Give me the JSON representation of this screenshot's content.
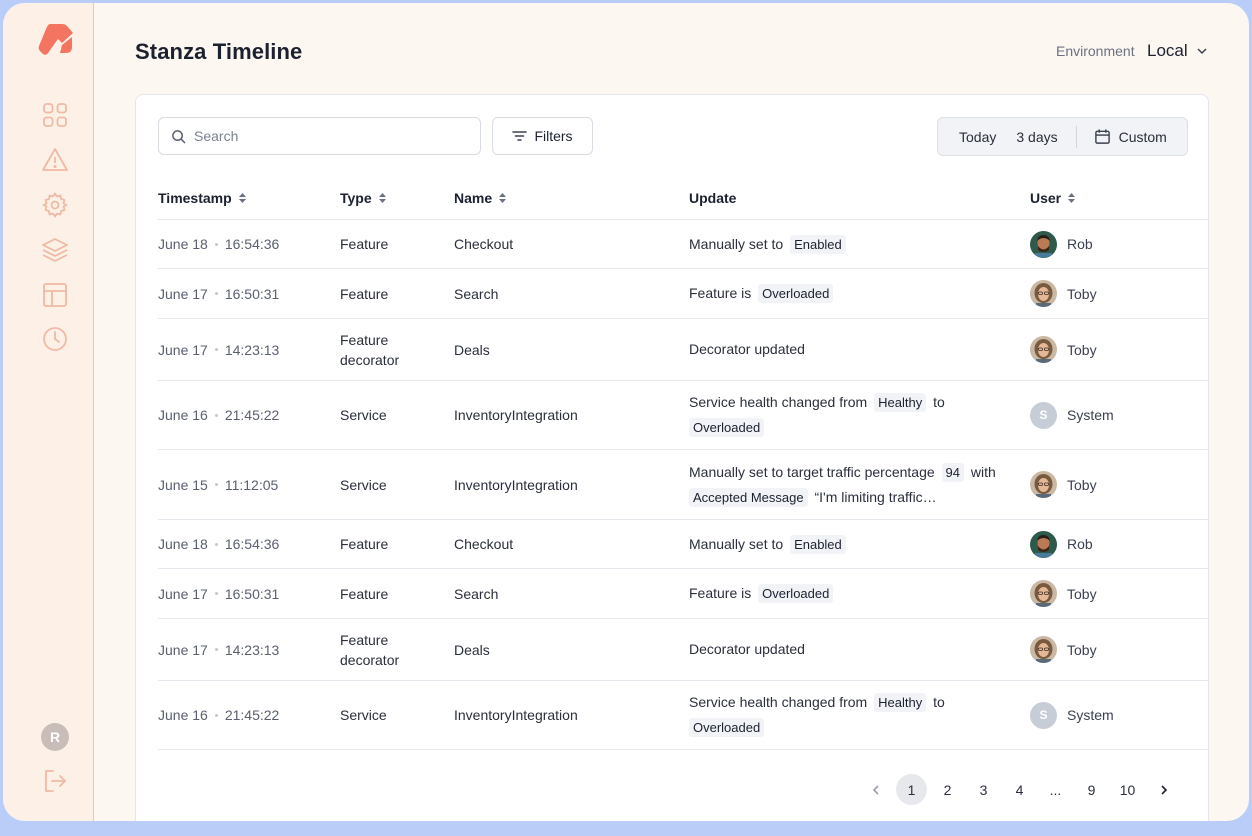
{
  "header": {
    "title": "Stanza Timeline",
    "environment_label": "Environment",
    "environment_value": "Local"
  },
  "sidebar": {
    "items": [
      {
        "icon": "dashboard-icon"
      },
      {
        "icon": "alert-icon"
      },
      {
        "icon": "settings-gear-icon"
      },
      {
        "icon": "layers-icon"
      },
      {
        "icon": "layout-icon"
      },
      {
        "icon": "clock-icon"
      }
    ],
    "user_initial": "R",
    "logout_icon": "logout-icon"
  },
  "toolbar": {
    "search_placeholder": "Search",
    "filters_label": "Filters",
    "range_today": "Today",
    "range_3days": "3 days",
    "range_custom": "Custom"
  },
  "table": {
    "columns": [
      "Timestamp",
      "Type",
      "Name",
      "Update",
      "User"
    ],
    "rows": [
      {
        "date": "June 18",
        "time": "16:54:36",
        "type": "Feature",
        "name": "Checkout",
        "update_text": "Manually set to",
        "update_tag": "Enabled",
        "user": "Rob",
        "avatar": "rob"
      },
      {
        "date": "June 17",
        "time": "16:50:31",
        "type": "Feature",
        "name": "Search",
        "update_text": "Feature is",
        "update_tag": "Overloaded",
        "user": "Toby",
        "avatar": "toby"
      },
      {
        "date": "June 17",
        "time": "14:23:13",
        "type": "Feature decorator",
        "name": "Deals",
        "update_text": "Decorator updated",
        "user": "Toby",
        "avatar": "toby"
      },
      {
        "date": "June 16",
        "time": "21:45:22",
        "type": "Service",
        "name": "InventoryIntegration",
        "update_text": "Service health changed from",
        "update_tag": "Healthy",
        "update_mid": "to",
        "update_tag2": "Overloaded",
        "user": "System",
        "avatar": "system"
      },
      {
        "date": "June 15",
        "time": "11:12:05",
        "type": "Service",
        "name": "InventoryIntegration",
        "update_text": "Manually set to target traffic percentage",
        "update_tag": "94",
        "update_mid": "with",
        "update_tag2": "Accepted Message",
        "update_tail": "“I'm limiting traffic…",
        "user": "Toby",
        "avatar": "toby"
      },
      {
        "date": "June 18",
        "time": "16:54:36",
        "type": "Feature",
        "name": "Checkout",
        "update_text": "Manually set to",
        "update_tag": "Enabled",
        "user": "Rob",
        "avatar": "rob"
      },
      {
        "date": "June 17",
        "time": "16:50:31",
        "type": "Feature",
        "name": "Search",
        "update_text": "Feature is",
        "update_tag": "Overloaded",
        "user": "Toby",
        "avatar": "toby"
      },
      {
        "date": "June 17",
        "time": "14:23:13",
        "type": "Feature decorator",
        "name": "Deals",
        "update_text": "Decorator updated",
        "user": "Toby",
        "avatar": "toby"
      },
      {
        "date": "June 16",
        "time": "21:45:22",
        "type": "Service",
        "name": "InventoryIntegration",
        "update_text": "Service health changed from",
        "update_tag": "Healthy",
        "update_mid": "to",
        "update_tag2": "Overloaded",
        "user": "System",
        "avatar": "system"
      }
    ],
    "system_initial": "S"
  },
  "pagination": {
    "pages": [
      "1",
      "2",
      "3",
      "4",
      "...",
      "9",
      "10"
    ],
    "current": "1"
  },
  "colors": {
    "accent": "#f37561",
    "sidebar_icon": "#f0b9a4",
    "background": "#b9cdf8"
  }
}
